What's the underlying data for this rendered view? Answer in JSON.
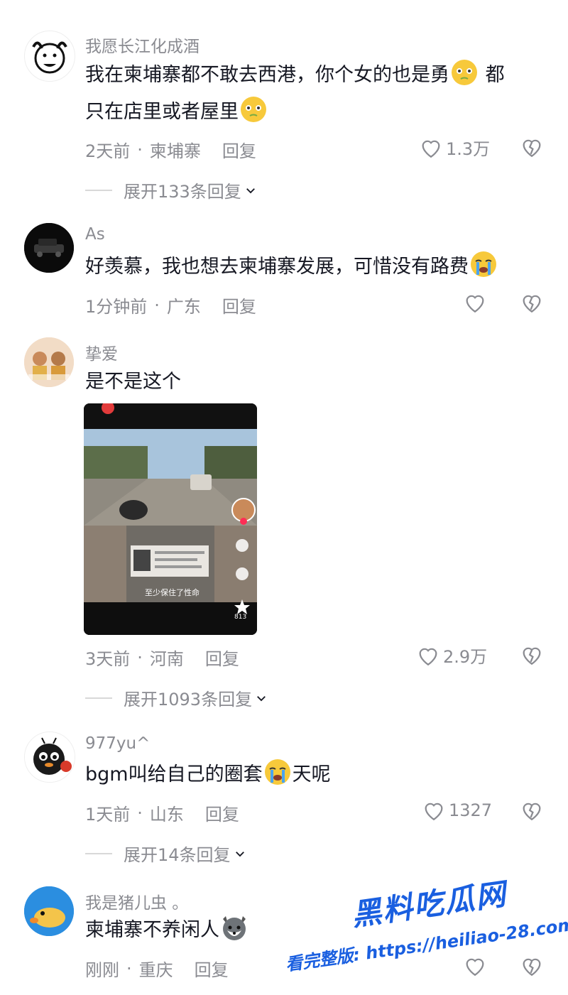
{
  "comments": [
    {
      "username": "我愿长江化成酒",
      "text_line1": "我在柬埔寨都不敢去西港，你个女的也是勇",
      "text_line1_end": "都",
      "text_line2": "只在店里或者屋里",
      "time": "2天前",
      "location": "柬埔寨",
      "reply": "回复",
      "likes": "1.3万",
      "expand": "展开133条回复"
    },
    {
      "username": "As",
      "text": "好羡慕，我也想去柬埔寨发展，可惜没有路费",
      "time": "1分钟前",
      "location": "广东",
      "reply": "回复",
      "likes": ""
    },
    {
      "username": "挚爱",
      "text": "是不是这个",
      "media_caption": "至少保住了性命",
      "media_count": "813",
      "time": "3天前",
      "location": "河南",
      "reply": "回复",
      "likes": "2.9万",
      "expand": "展开1093条回复"
    },
    {
      "username": "977yu^",
      "text_before": "bgm叫给自己的圈套",
      "text_after": "天呢",
      "time": "1天前",
      "location": "山东",
      "reply": "回复",
      "likes": "1327",
      "expand": "展开14条回复"
    },
    {
      "username": "我是猪儿虫 。",
      "text": "柬埔寨不养闲人",
      "time": "刚刚",
      "location": "重庆",
      "reply": "回复",
      "likes": ""
    }
  ],
  "watermark": {
    "title": "黑料吃瓜网",
    "subtitle": "看完整版: https://heiliao-28.com"
  },
  "colors": {
    "text": "#161823",
    "secondary": "#8a8b91",
    "watermark": "#1a5fe0"
  }
}
